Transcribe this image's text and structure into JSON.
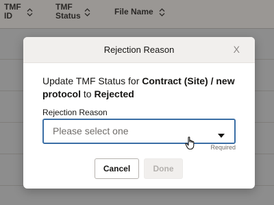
{
  "table": {
    "columns": [
      {
        "label_line1": "TMF",
        "label_line2": "ID"
      },
      {
        "label_line1": "TMF",
        "label_line2": "Status"
      },
      {
        "label_line1": "File Name",
        "label_line2": ""
      }
    ]
  },
  "dialog": {
    "title": "Rejection Reason",
    "close_label": "X",
    "message_prefix": "Update TMF Status for ",
    "message_document": "Contract (Site) / new protocol",
    "message_middle": " to ",
    "message_status": "Rejected",
    "field_label": "Rejection Reason",
    "select_placeholder": "Please select one",
    "required_label": "Required",
    "cancel_label": "Cancel",
    "done_label": "Done"
  },
  "icons": {
    "sort": "sort-icon",
    "caret": "caret-down-icon",
    "cursor": "hand-cursor-icon"
  },
  "colors": {
    "select_border": "#3a6ea5",
    "overlay": "#8d8d8d",
    "header_bg": "#f1efed"
  }
}
